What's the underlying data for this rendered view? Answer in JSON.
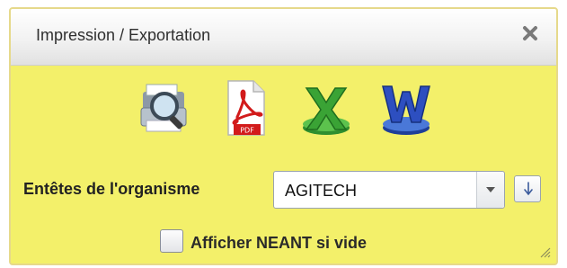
{
  "dialog": {
    "title": "Impression / Exportation",
    "close_icon": "close-icon"
  },
  "export_icons": [
    {
      "name": "print-preview-icon"
    },
    {
      "name": "pdf-icon",
      "badge": "PDF"
    },
    {
      "name": "excel-icon"
    },
    {
      "name": "word-icon"
    }
  ],
  "header_org": {
    "label": "Entêtes de l'organisme",
    "selected": "AGITECH",
    "dropdown_icon": "chevron-down-icon",
    "sort_icon": "arrow-down-icon"
  },
  "options": {
    "show_neant_label": "Afficher NEANT si vide",
    "show_neant_checked": false
  },
  "colors": {
    "panel_bg": "#f3f06a",
    "titlebar": "#eeeeee"
  }
}
